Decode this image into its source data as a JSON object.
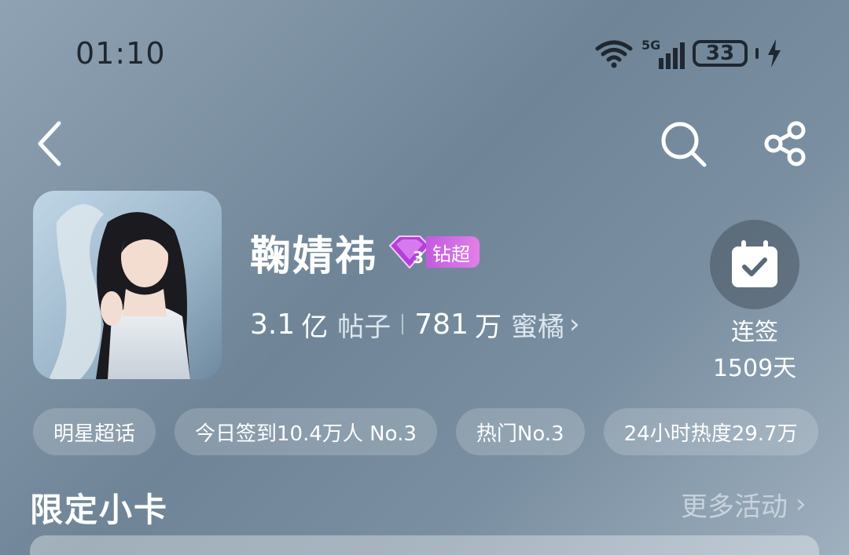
{
  "status_bar": {
    "time": "01:10",
    "network": "5G",
    "battery": "33"
  },
  "nav": {
    "back_icon": "chevron-left-icon",
    "search_icon": "search-icon",
    "share_icon": "share-icon"
  },
  "topic": {
    "name": "鞠婧祎",
    "badge_level": "3",
    "badge_text": "钻超",
    "posts_value": "3.1",
    "posts_unit": "亿",
    "posts_label": "帖子",
    "fans_value": "781",
    "fans_unit": "万",
    "fans_label": "蜜橘",
    "fans_chevron": "›"
  },
  "checkin": {
    "label": "连签",
    "days": "1509天"
  },
  "chips": [
    {
      "label": "明星超话"
    },
    {
      "label": "今日签到10.4万人 No.3"
    },
    {
      "label": "热门No.3"
    },
    {
      "label": "24小时热度29.7万"
    }
  ],
  "section": {
    "title": "限定小卡",
    "more_label": "更多活动",
    "more_chevron": "›"
  },
  "colors": {
    "badge": "#c35ae0",
    "background": "#7a8fa1"
  }
}
